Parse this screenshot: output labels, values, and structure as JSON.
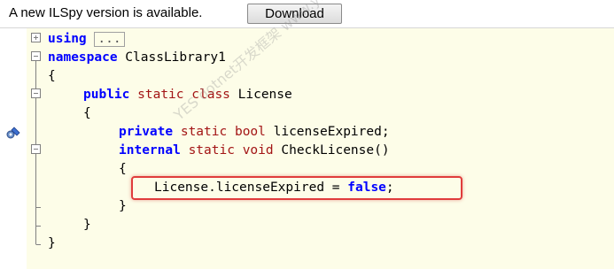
{
  "update_bar": {
    "message": "A new ILSpy version is available.",
    "download_label": "Download"
  },
  "code": {
    "line1": {
      "keyword": "using",
      "collapsed": "..."
    },
    "line2": {
      "keyword": "namespace",
      "name": " ClassLibrary1"
    },
    "line3": {
      "text": "{"
    },
    "line4": {
      "kw1": "public",
      "kw2": "static",
      "kw3": "class",
      "name": " License"
    },
    "line5": {
      "text": "{"
    },
    "line6": {
      "kw1": "private",
      "kw2": "static",
      "kw3": "bool",
      "name": " licenseExpired;"
    },
    "line7": {
      "kw1": "internal",
      "kw2": "static",
      "kw3": "void",
      "name": " CheckLicense()"
    },
    "line8": {
      "text": "{"
    },
    "line9": {
      "text": "License.licenseExpired = ",
      "value": "false",
      "end": ";"
    },
    "line10": {
      "text": "}"
    },
    "line11": {
      "text": "}"
    },
    "line12": {
      "text": "}"
    }
  },
  "watermark": "YES dotnet开发框架 www.yesdotnet.com",
  "colors": {
    "keyword_blue": "#0000ff",
    "keyword_red": "#a31515",
    "editor_bg": "#fdfde8",
    "highlight_border": "#e03c3c"
  }
}
